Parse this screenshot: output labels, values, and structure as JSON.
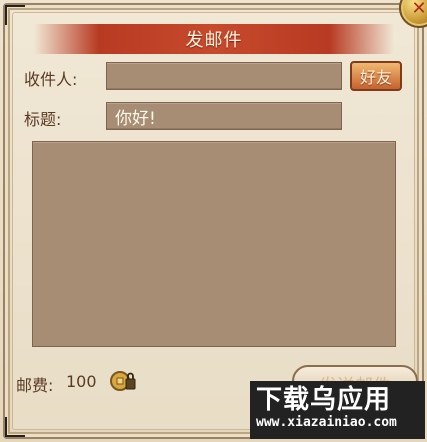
{
  "dialog": {
    "title": "发邮件",
    "close_icon": "close-icon"
  },
  "form": {
    "recipient_label": "收件人:",
    "recipient_value": "",
    "friend_button_label": "好友",
    "subject_label": "标题:",
    "subject_value": "你好!",
    "message_value": ""
  },
  "footer": {
    "postage_label": "邮费:",
    "postage_value": "100",
    "coin_icon": "coin-lock-icon",
    "send_button_label": "发送邮件"
  },
  "watermark": {
    "title": "下载乌应用",
    "url": "www.xiazainiao.com"
  },
  "colors": {
    "background": "#e7dcc5",
    "title_bar": "#c84a2d",
    "input_fill": "#a68d73",
    "text": "#5a3b24",
    "button_orange": "#c6622f"
  }
}
